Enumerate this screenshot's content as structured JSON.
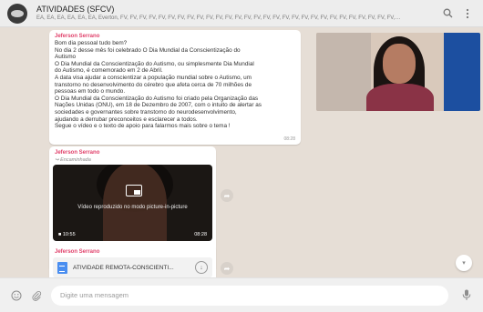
{
  "header": {
    "title": "ATIVIDADES (SFCV)",
    "participants": "EA, EA, EA, EA, EA, EA, Everton, FV, FV, FV, FV, FV, FV, FV, FV, FV, FV, FV, FV, FV, FV, FV, FV, FV, FV, FV, FV, FV, FV, FV, FV, FV, FV, FV, FV, FV, FV, FV, FV, FV, FV, FV, ..."
  },
  "messages": [
    {
      "sender": "Jeferson Serrano",
      "lines": [
        "Bom dia pessoal tudo bem?",
        "No dia 2  desse mês foi celebrado O Dia Mundial da Conscientização do",
        "Autismo",
        "O Dia Mundial da Conscientização do Autismo, ou simplesmente Dia Mundial",
        "do Autismo, é comemorado em 2 de Abril.",
        "A data visa ajudar a conscientizar a população mundial sobre o Autismo, um",
        "transtorno no desenvolvimento do cérebro que afeta cerca de 70 milhões de",
        "pessoas em todo o mundo.",
        "O Dia Mundial da Conscientização do Autismo foi criado pela Organização das",
        "Nações Unidas (ONU), em 18 de Dezembro de 2007, com o intuito de alertar as",
        "sociedades e governantes sobre transtorno do neurodesenvolvimento,",
        "ajudando a derrubar preconceitos e esclarecer a todos.",
        "Segue o vídeo e o texto de apoio para falarmos mais sobre o tema !"
      ],
      "time": "08:28"
    },
    {
      "sender": "Jeferson Serrano",
      "forwarded": "Encaminhada",
      "video": {
        "pip_text": "Vídeo reproduzido no modo picture-in-picture",
        "duration": "10:55",
        "time": "08:28"
      }
    },
    {
      "sender": "Jeferson Serrano",
      "document": {
        "name": "ATIVIDADE REMOTA-CONSCIENTI..."
      }
    }
  ],
  "composer": {
    "placeholder": "Digite uma mensagem"
  },
  "icons": {
    "search": "search-icon",
    "menu": "menu-icon",
    "emoji": "emoji-icon",
    "attach": "attach-icon",
    "mic": "mic-icon",
    "scroll": "chevron-down-icon",
    "forward": "forward-icon",
    "download": "download-icon"
  }
}
